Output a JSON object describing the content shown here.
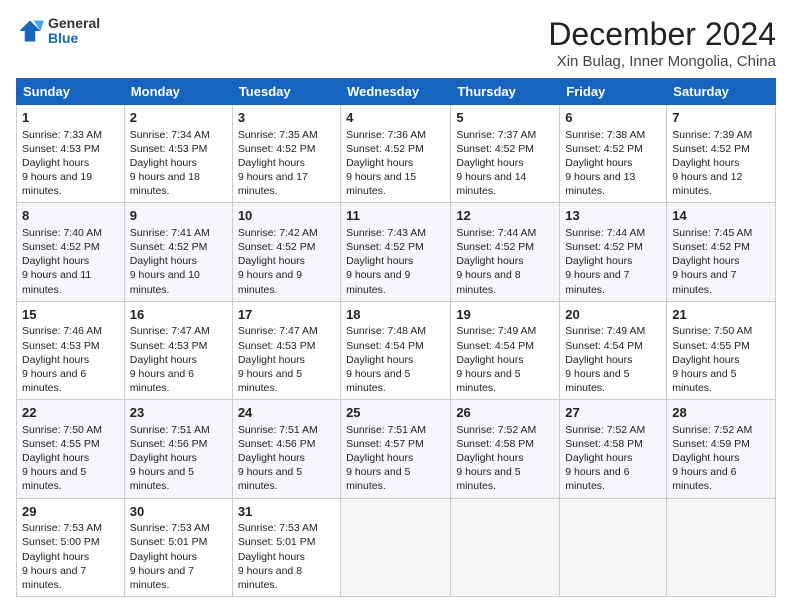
{
  "header": {
    "logo_general": "General",
    "logo_blue": "Blue",
    "month": "December 2024",
    "location": "Xin Bulag, Inner Mongolia, China"
  },
  "weekdays": [
    "Sunday",
    "Monday",
    "Tuesday",
    "Wednesday",
    "Thursday",
    "Friday",
    "Saturday"
  ],
  "weeks": [
    [
      {
        "day": "1",
        "sunrise": "7:33 AM",
        "sunset": "4:53 PM",
        "daylight": "9 hours and 19 minutes."
      },
      {
        "day": "2",
        "sunrise": "7:34 AM",
        "sunset": "4:53 PM",
        "daylight": "9 hours and 18 minutes."
      },
      {
        "day": "3",
        "sunrise": "7:35 AM",
        "sunset": "4:52 PM",
        "daylight": "9 hours and 17 minutes."
      },
      {
        "day": "4",
        "sunrise": "7:36 AM",
        "sunset": "4:52 PM",
        "daylight": "9 hours and 15 minutes."
      },
      {
        "day": "5",
        "sunrise": "7:37 AM",
        "sunset": "4:52 PM",
        "daylight": "9 hours and 14 minutes."
      },
      {
        "day": "6",
        "sunrise": "7:38 AM",
        "sunset": "4:52 PM",
        "daylight": "9 hours and 13 minutes."
      },
      {
        "day": "7",
        "sunrise": "7:39 AM",
        "sunset": "4:52 PM",
        "daylight": "9 hours and 12 minutes."
      }
    ],
    [
      {
        "day": "8",
        "sunrise": "7:40 AM",
        "sunset": "4:52 PM",
        "daylight": "9 hours and 11 minutes."
      },
      {
        "day": "9",
        "sunrise": "7:41 AM",
        "sunset": "4:52 PM",
        "daylight": "9 hours and 10 minutes."
      },
      {
        "day": "10",
        "sunrise": "7:42 AM",
        "sunset": "4:52 PM",
        "daylight": "9 hours and 9 minutes."
      },
      {
        "day": "11",
        "sunrise": "7:43 AM",
        "sunset": "4:52 PM",
        "daylight": "9 hours and 9 minutes."
      },
      {
        "day": "12",
        "sunrise": "7:44 AM",
        "sunset": "4:52 PM",
        "daylight": "9 hours and 8 minutes."
      },
      {
        "day": "13",
        "sunrise": "7:44 AM",
        "sunset": "4:52 PM",
        "daylight": "9 hours and 7 minutes."
      },
      {
        "day": "14",
        "sunrise": "7:45 AM",
        "sunset": "4:52 PM",
        "daylight": "9 hours and 7 minutes."
      }
    ],
    [
      {
        "day": "15",
        "sunrise": "7:46 AM",
        "sunset": "4:53 PM",
        "daylight": "9 hours and 6 minutes."
      },
      {
        "day": "16",
        "sunrise": "7:47 AM",
        "sunset": "4:53 PM",
        "daylight": "9 hours and 6 minutes."
      },
      {
        "day": "17",
        "sunrise": "7:47 AM",
        "sunset": "4:53 PM",
        "daylight": "9 hours and 5 minutes."
      },
      {
        "day": "18",
        "sunrise": "7:48 AM",
        "sunset": "4:54 PM",
        "daylight": "9 hours and 5 minutes."
      },
      {
        "day": "19",
        "sunrise": "7:49 AM",
        "sunset": "4:54 PM",
        "daylight": "9 hours and 5 minutes."
      },
      {
        "day": "20",
        "sunrise": "7:49 AM",
        "sunset": "4:54 PM",
        "daylight": "9 hours and 5 minutes."
      },
      {
        "day": "21",
        "sunrise": "7:50 AM",
        "sunset": "4:55 PM",
        "daylight": "9 hours and 5 minutes."
      }
    ],
    [
      {
        "day": "22",
        "sunrise": "7:50 AM",
        "sunset": "4:55 PM",
        "daylight": "9 hours and 5 minutes."
      },
      {
        "day": "23",
        "sunrise": "7:51 AM",
        "sunset": "4:56 PM",
        "daylight": "9 hours and 5 minutes."
      },
      {
        "day": "24",
        "sunrise": "7:51 AM",
        "sunset": "4:56 PM",
        "daylight": "9 hours and 5 minutes."
      },
      {
        "day": "25",
        "sunrise": "7:51 AM",
        "sunset": "4:57 PM",
        "daylight": "9 hours and 5 minutes."
      },
      {
        "day": "26",
        "sunrise": "7:52 AM",
        "sunset": "4:58 PM",
        "daylight": "9 hours and 5 minutes."
      },
      {
        "day": "27",
        "sunrise": "7:52 AM",
        "sunset": "4:58 PM",
        "daylight": "9 hours and 6 minutes."
      },
      {
        "day": "28",
        "sunrise": "7:52 AM",
        "sunset": "4:59 PM",
        "daylight": "9 hours and 6 minutes."
      }
    ],
    [
      {
        "day": "29",
        "sunrise": "7:53 AM",
        "sunset": "5:00 PM",
        "daylight": "9 hours and 7 minutes."
      },
      {
        "day": "30",
        "sunrise": "7:53 AM",
        "sunset": "5:01 PM",
        "daylight": "9 hours and 7 minutes."
      },
      {
        "day": "31",
        "sunrise": "7:53 AM",
        "sunset": "5:01 PM",
        "daylight": "9 hours and 8 minutes."
      },
      null,
      null,
      null,
      null
    ]
  ],
  "labels": {
    "sunrise": "Sunrise:",
    "sunset": "Sunset:",
    "daylight": "Daylight hours"
  }
}
